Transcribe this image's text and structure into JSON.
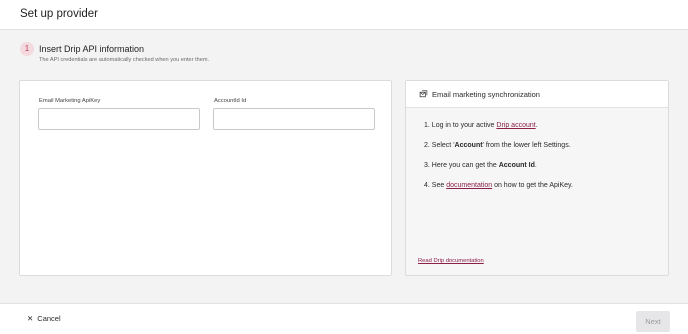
{
  "header": {
    "title": "Set up provider"
  },
  "step": {
    "number": "1",
    "title": "Insert Drip API information",
    "subtitle": "The API credentials are automatically checked when you enter them."
  },
  "form": {
    "apikey_label": "Email Marketing ApiKey",
    "apikey_value": "",
    "accountid_label": "AccountId Id",
    "accountid_value": ""
  },
  "info": {
    "icon": "mail-sync-icon",
    "title": "Email marketing synchronization",
    "items": [
      {
        "num": "1.",
        "pre": "Log in to your active ",
        "link": "Drip account",
        "post": "."
      },
      {
        "num": "2.",
        "pre": "Select '",
        "bold": "Account",
        "post": "' from the lower left Settings."
      },
      {
        "num": "3.",
        "pre": "Here you can get the ",
        "bold": "Account Id",
        "post": "."
      },
      {
        "num": "4.",
        "pre": "See ",
        "link": "documentation",
        "post": " on how to get the ApiKey."
      }
    ],
    "doc_link": "Read Drip documentation"
  },
  "footer": {
    "cancel_label": "Cancel",
    "next_label": "Next"
  },
  "colors": {
    "accent": "#8b1f47",
    "step_bg": "#f4d9df"
  }
}
